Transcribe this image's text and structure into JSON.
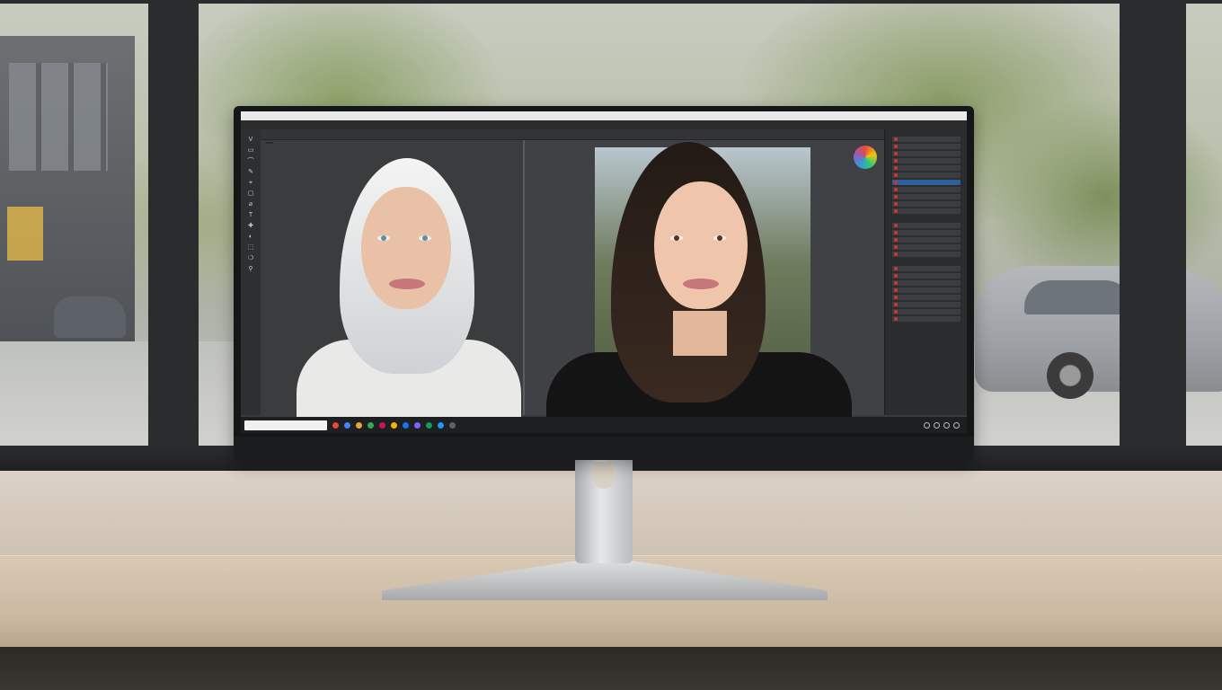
{
  "editor": {
    "title_items": [
      "",
      "",
      "",
      ""
    ],
    "menu": [
      "",
      "",
      "",
      "",
      "",
      "",
      "",
      "",
      "",
      "",
      "",
      "",
      "",
      "",
      "",
      "",
      "",
      "",
      "",
      "",
      "",
      "",
      "",
      "",
      "",
      "",
      "",
      "",
      ""
    ],
    "options": [
      "",
      "",
      "",
      "",
      "",
      "",
      "",
      "",
      "",
      "",
      "",
      "",
      "",
      "",
      "",
      "",
      "",
      "",
      "",
      "",
      ""
    ],
    "tools": [
      "V",
      "▭",
      "⌒",
      "✎",
      "⌖",
      "▢",
      "⌀",
      "T",
      "✚",
      "◐",
      "⬚",
      "❍",
      "⚲"
    ],
    "left_doc_tab": "",
    "right_doc_tab": "",
    "footer_tabs": [
      "",
      "",
      "",
      "",
      "",
      ""
    ],
    "taskbar_search": ""
  },
  "monitor": {
    "brand": ""
  },
  "colors": {
    "task_icons": [
      "#e04b3a",
      "#4285f4",
      "#e8a23a",
      "#34a853",
      "#c2185b",
      "#f4b400",
      "#1a73e8",
      "#7b61ff",
      "#0f9d58",
      "#2196f3",
      "#5f6368"
    ]
  }
}
